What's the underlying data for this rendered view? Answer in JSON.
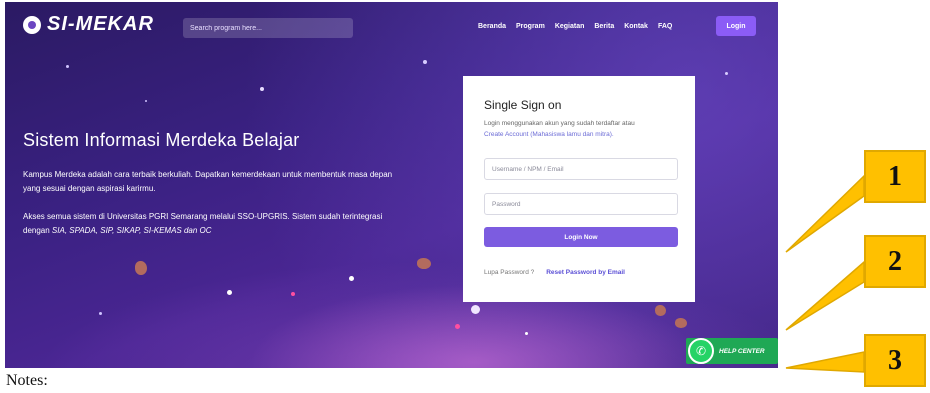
{
  "header": {
    "logo_text": "SI-MEKAR",
    "search_placeholder": "Search program here...",
    "nav": [
      "Beranda",
      "Program",
      "Kegiatan",
      "Berita",
      "Kontak",
      "FAQ"
    ],
    "login_label": "Login"
  },
  "hero": {
    "title": "Sistem Informasi Merdeka Belajar",
    "paragraph1": "Kampus Merdeka adalah cara terbaik berkuliah. Dapatkan kemerdekaan untuk membentuk masa depan yang sesuai dengan aspirasi karirmu.",
    "paragraph2_lead": "Akses semua sistem di Universitas PGRI Semarang melalui SSO-UPGRIS. Sistem sudah terintegrasi dengan ",
    "paragraph2_systems": "SIA, SPADA, SIP, SIKAP, SI-KEMAS dan OC"
  },
  "login_card": {
    "title": "Single Sign on",
    "subtitle": "Login menggunakan akun yang sudah terdaftar atau",
    "create_link": "Create Account (Mahasiswa lamu dan mitra).",
    "username_placeholder": "Username / NPM / Email",
    "password_placeholder": "Password",
    "submit_label": "Login Now",
    "forgot_label": "Lupa Password ?",
    "reset_label": "Reset Password by Email"
  },
  "help_center": {
    "label": "HELP CENTER"
  },
  "callouts": [
    "1",
    "2",
    "3"
  ],
  "notes_label": "Notes:",
  "colors": {
    "primary": "#7c5ce0",
    "callout": "#ffc000",
    "whatsapp": "#25d366"
  },
  "icons": [
    "logo-icon",
    "whatsapp-icon"
  ]
}
